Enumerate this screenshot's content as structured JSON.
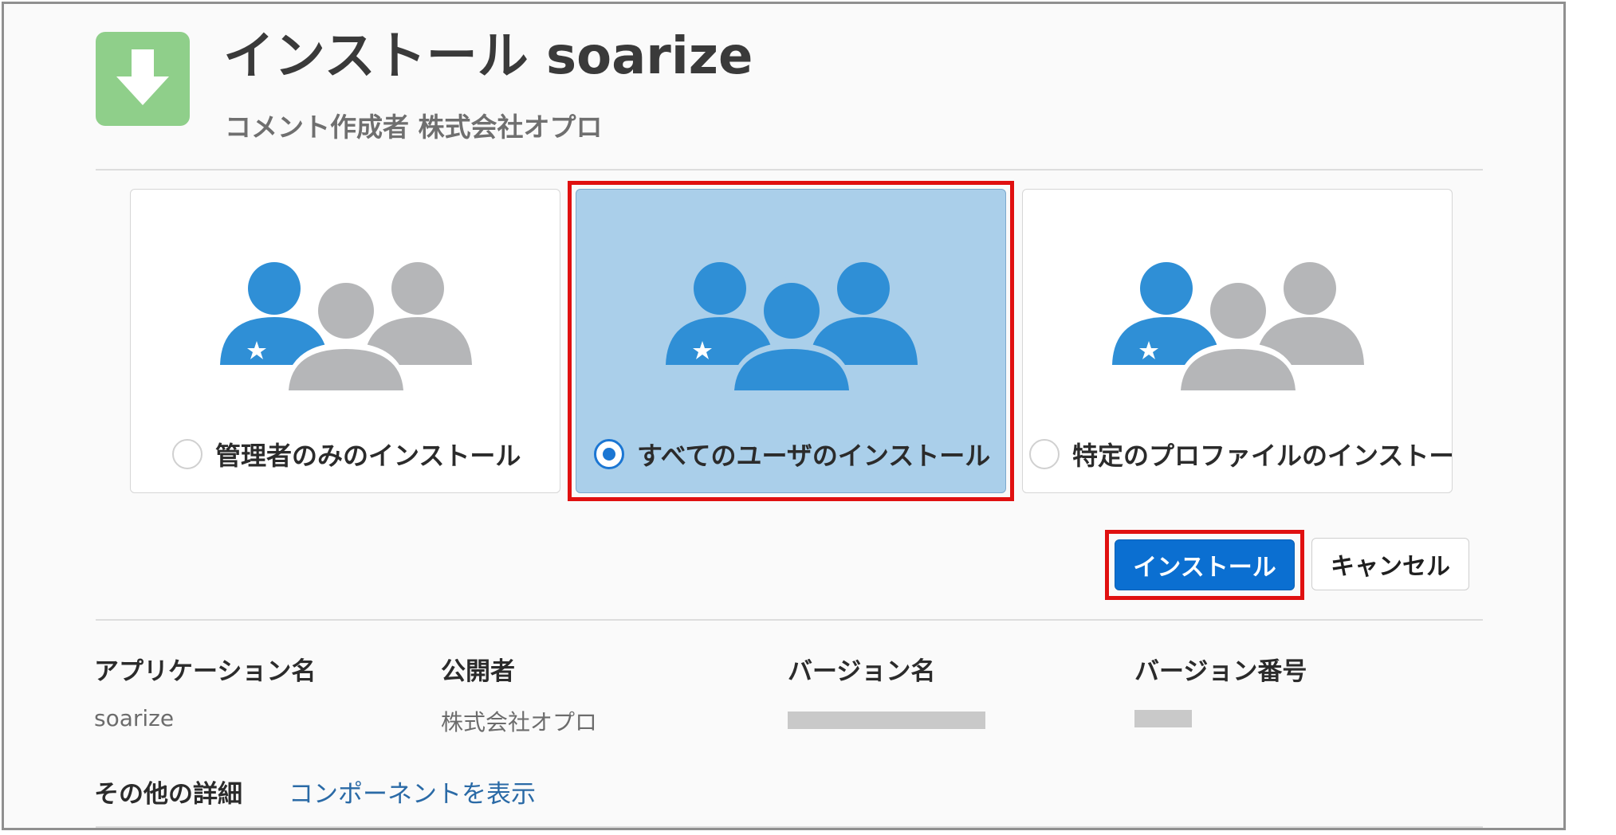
{
  "header": {
    "title": "インストール soarize",
    "subtitle": "コメント作成者 株式会社オプロ",
    "icon": "download-arrow-icon"
  },
  "install_options": [
    {
      "label": "管理者のみのインストール",
      "selected": false,
      "icon": "users-admin-icon"
    },
    {
      "label": "すべてのユーザのインストール",
      "selected": true,
      "icon": "users-all-icon"
    },
    {
      "label": "特定のプロファイルのインストー",
      "selected": false,
      "icon": "users-profile-icon"
    }
  ],
  "actions": {
    "install_label": "インストール",
    "cancel_label": "キャンセル"
  },
  "details": {
    "columns": [
      {
        "label": "アプリケーション名",
        "value": "soarize"
      },
      {
        "label": "公開者",
        "value": "株式会社オプロ"
      },
      {
        "label": "バージョン名",
        "value": ""
      },
      {
        "label": "バージョン番号",
        "value": ""
      }
    ],
    "more_label": "その他の詳細",
    "components_link": "コンポーネントを表示"
  },
  "colors": {
    "accent_blue": "#0b6fd1",
    "person_blue": "#2f8fd6",
    "person_gray": "#b5b6b8",
    "selected_card": "#aacfea",
    "highlight_red": "#e01010",
    "app_icon_green": "#8fcf8a"
  }
}
